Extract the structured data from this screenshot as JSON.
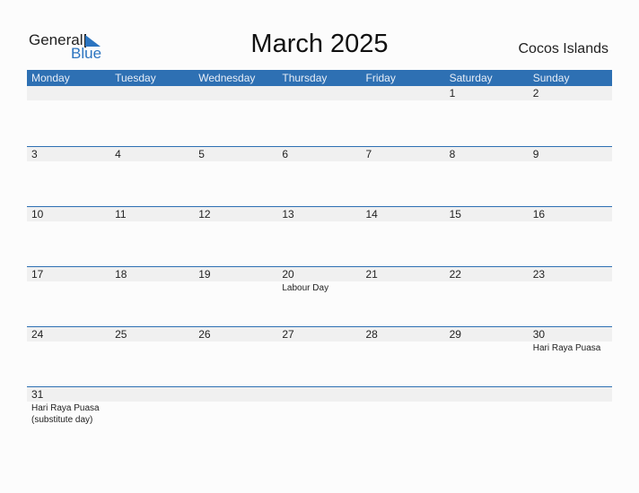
{
  "logo": {
    "part1": "General",
    "part2": "Blue"
  },
  "title": "March 2025",
  "country": "Cocos Islands",
  "colors": {
    "header": "#2e70b3",
    "band": "#f0f0f0",
    "accent": "#2b74c0"
  },
  "weekdays": [
    "Monday",
    "Tuesday",
    "Wednesday",
    "Thursday",
    "Friday",
    "Saturday",
    "Sunday"
  ],
  "weeks": [
    [
      {
        "day": ""
      },
      {
        "day": ""
      },
      {
        "day": ""
      },
      {
        "day": ""
      },
      {
        "day": ""
      },
      {
        "day": "1"
      },
      {
        "day": "2"
      }
    ],
    [
      {
        "day": "3"
      },
      {
        "day": "4"
      },
      {
        "day": "5"
      },
      {
        "day": "6"
      },
      {
        "day": "7"
      },
      {
        "day": "8"
      },
      {
        "day": "9"
      }
    ],
    [
      {
        "day": "10"
      },
      {
        "day": "11"
      },
      {
        "day": "12"
      },
      {
        "day": "13"
      },
      {
        "day": "14"
      },
      {
        "day": "15"
      },
      {
        "day": "16"
      }
    ],
    [
      {
        "day": "17"
      },
      {
        "day": "18"
      },
      {
        "day": "19"
      },
      {
        "day": "20",
        "holiday": "Labour Day"
      },
      {
        "day": "21"
      },
      {
        "day": "22"
      },
      {
        "day": "23"
      }
    ],
    [
      {
        "day": "24"
      },
      {
        "day": "25"
      },
      {
        "day": "26"
      },
      {
        "day": "27"
      },
      {
        "day": "28"
      },
      {
        "day": "29"
      },
      {
        "day": "30",
        "holiday": "Hari Raya Puasa"
      }
    ],
    [
      {
        "day": "31",
        "holiday": "Hari Raya Puasa (substitute day)"
      },
      {
        "day": ""
      },
      {
        "day": ""
      },
      {
        "day": ""
      },
      {
        "day": ""
      },
      {
        "day": ""
      },
      {
        "day": ""
      }
    ]
  ]
}
